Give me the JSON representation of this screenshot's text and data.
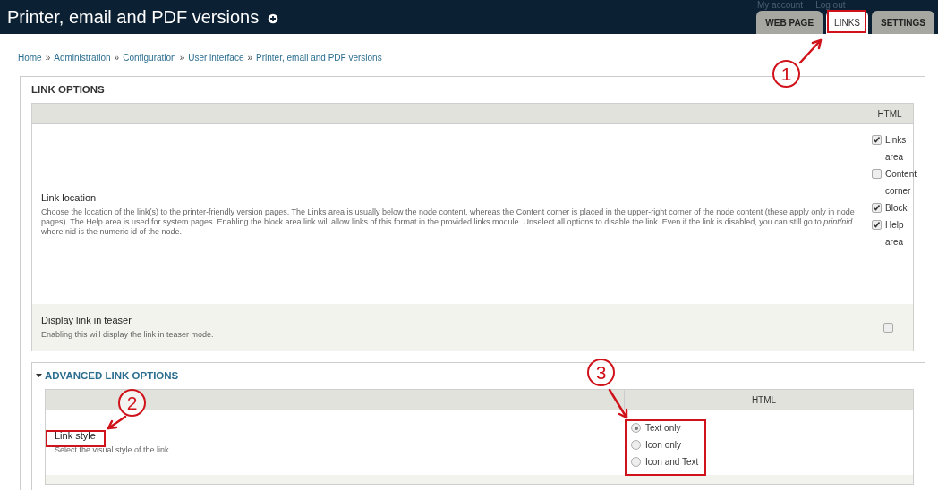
{
  "header": {
    "title": "Printer, email and PDF versions",
    "user_links": [
      "My account",
      "Log out"
    ],
    "tabs": [
      {
        "label": "WEB PAGE",
        "selected": false
      },
      {
        "label": "LINKS",
        "selected": true
      },
      {
        "label": "SETTINGS",
        "selected": false
      }
    ]
  },
  "breadcrumb": {
    "separator": "»",
    "items": [
      "Home",
      "Administration",
      "Configuration",
      "User interface",
      "Printer, email and PDF versions"
    ]
  },
  "link_options": {
    "legend": "LINK OPTIONS",
    "column_header": "HTML",
    "rows": [
      {
        "kind": "checkboxes",
        "title": "Link location",
        "description": "Choose the location of the link(s) to the printer-friendly version pages. The Links area is usually below the node content, whereas the Content corner is placed in the upper-right corner of the node content (these apply only in node pages). The Help area is used for system pages. Enabling the block area link will allow links of this format in the provided links module. Unselect all options to disable the link. Even if the link is disabled, you can still go to *print/nid* where nid is the numeric id of the node.",
        "options": [
          {
            "label": "Links area",
            "checked": true
          },
          {
            "label": "Content corner",
            "checked": false
          },
          {
            "label": "Block",
            "checked": true
          },
          {
            "label": "Help area",
            "checked": true
          }
        ]
      },
      {
        "kind": "checkbox",
        "title": "Display link in teaser",
        "description": "Enabling this will display the link in teaser mode.",
        "checked": false
      }
    ]
  },
  "advanced": {
    "legend": "ADVANCED LINK OPTIONS",
    "expanded": true,
    "column_header": "HTML",
    "rows": [
      {
        "kind": "radios",
        "title": "Link style",
        "description": "Select the visual style of the link.",
        "options": [
          {
            "label": "Text only",
            "selected": true
          },
          {
            "label": "Icon only",
            "selected": false
          },
          {
            "label": "Icon and Text",
            "selected": false
          }
        ]
      }
    ]
  },
  "annotations": [
    {
      "number": "1"
    },
    {
      "number": "2"
    },
    {
      "number": "3"
    }
  ]
}
